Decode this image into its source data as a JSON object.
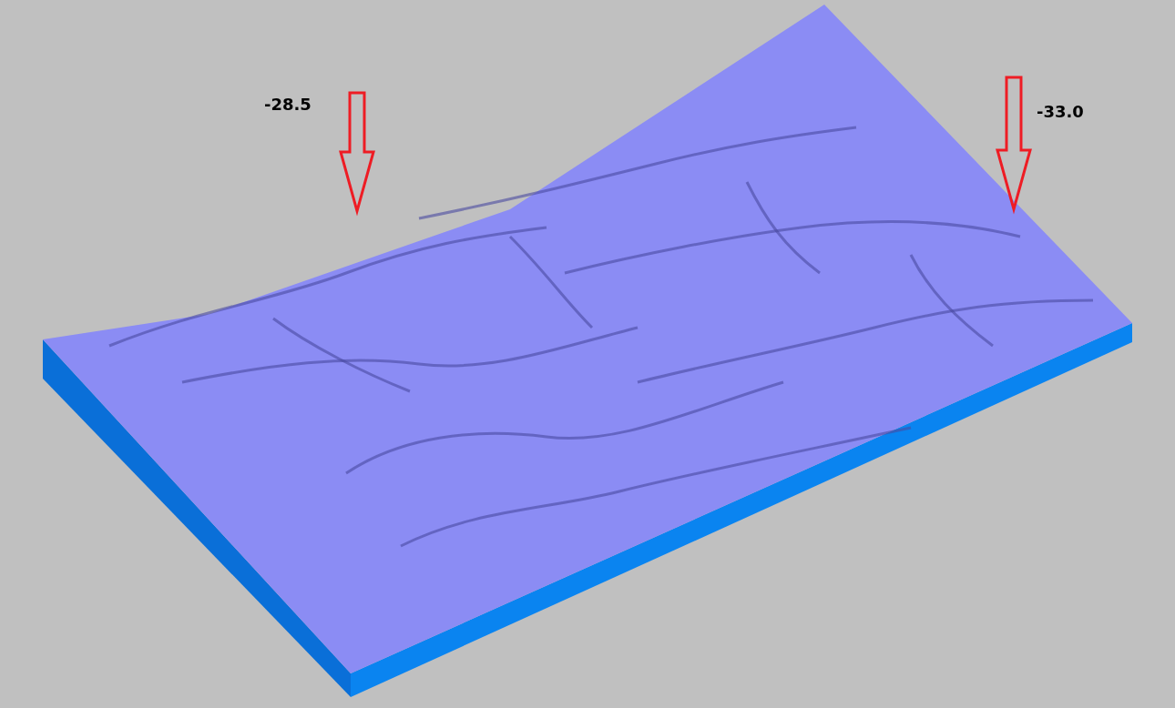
{
  "annotations": [
    {
      "label": "-28.5"
    },
    {
      "label": "-33.0"
    }
  ]
}
